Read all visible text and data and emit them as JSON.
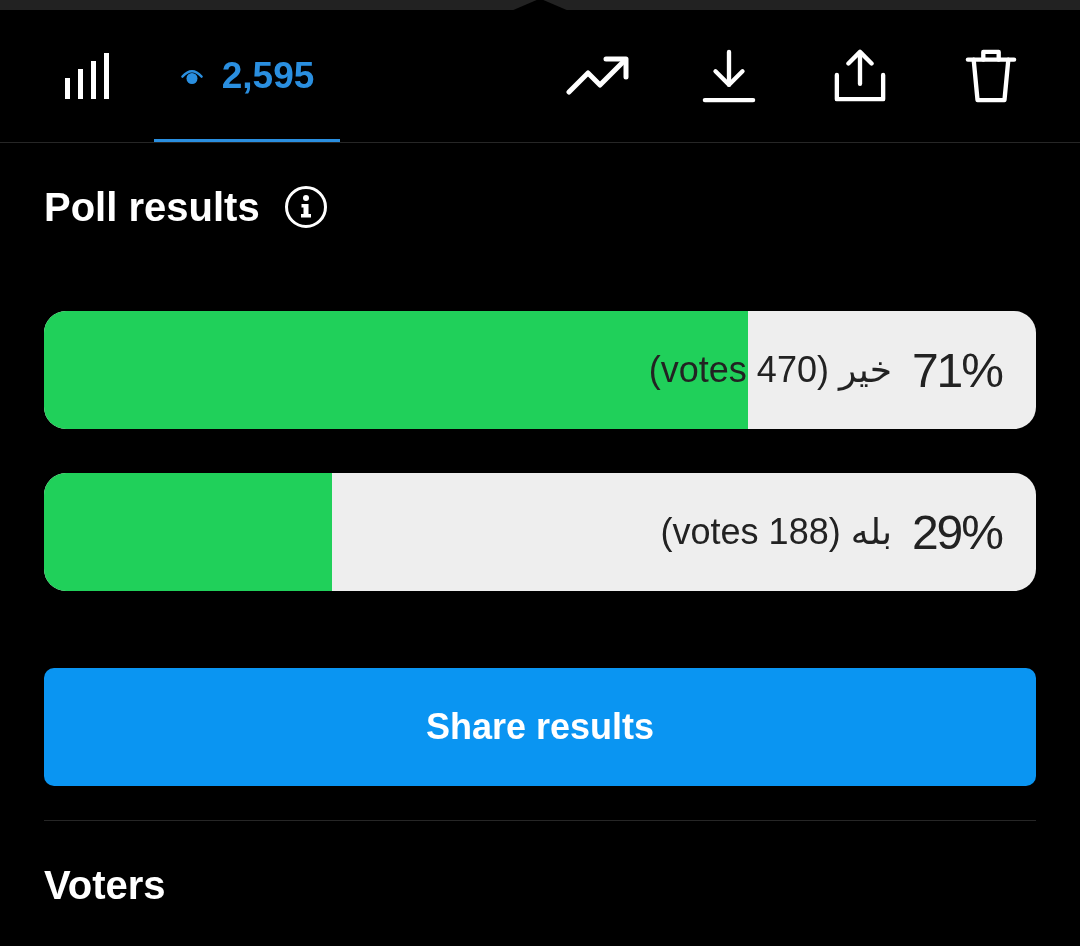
{
  "toolbar": {
    "tabs": [
      {
        "kind": "chart",
        "selected": false
      },
      {
        "kind": "views",
        "label": "2,595",
        "selected": true
      }
    ],
    "actions": [
      {
        "kind": "trend"
      },
      {
        "kind": "download"
      },
      {
        "kind": "share"
      },
      {
        "kind": "delete"
      }
    ]
  },
  "poll": {
    "title": "Poll results",
    "options": [
      {
        "label": "خیر (470 votes)",
        "percent": "71%",
        "level": 0.71
      },
      {
        "label": "بله (188 votes)",
        "percent": "29%",
        "level": 0.29
      }
    ],
    "share_button": "Share results"
  },
  "voters": {
    "title": "Voters"
  }
}
